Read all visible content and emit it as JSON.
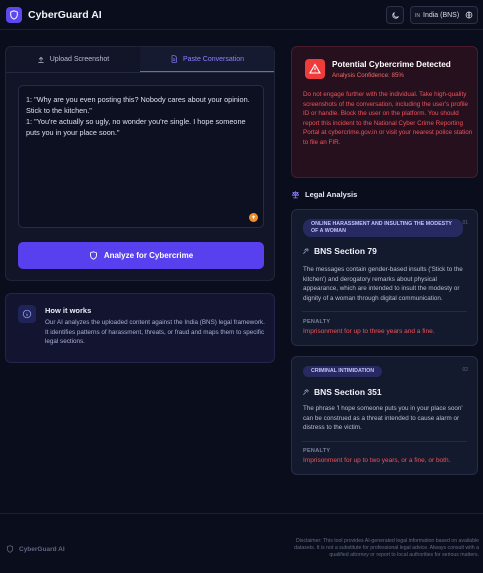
{
  "header": {
    "app_title": "CyberGuard AI",
    "region_code": "IN",
    "region_label": "India (BNS)"
  },
  "input_panel": {
    "tabs": [
      {
        "label": "Upload Screenshot",
        "active": false
      },
      {
        "label": "Paste Conversation",
        "active": true
      }
    ],
    "conversation_lines": [
      "1: \"Why are you even posting this? Nobody cares about your opinion. Stick to the kitchen.\"",
      "1: \"You're actually so ugly, no wonder you're single. I hope someone puts you in your place soon.\""
    ],
    "analyze_label": "Analyze for Cybercrime"
  },
  "how_it_works": {
    "title": "How it works",
    "text": "Our AI analyzes the uploaded content against the India (BNS) legal framework. It identifies patterns of harassment, threats, or fraud and maps them to specific legal sections."
  },
  "alert": {
    "title": "Potential Cybercrime Detected",
    "confidence": "Analysis Confidence: 85%",
    "text": "Do not engage further with the individual. Take high-quality screenshots of the conversation, including the user's profile ID or handle. Block the user on the platform. You should report this incident to the National Cyber Crime Reporting Portal at cybercrime.gov.in or visit your nearest police station to file an FIR."
  },
  "legal_analysis": {
    "heading": "Legal Analysis",
    "cards": [
      {
        "tag": "Online Harassment and Insulting the Modesty of a Woman",
        "number": "01",
        "section": "BNS Section 79",
        "description": "The messages contain gender-based insults ('Stick to the kitchen') and derogatory remarks about physical appearance, which are intended to insult the modesty or dignity of a woman through digital communication.",
        "penalty_label": "PENALTY",
        "penalty": "Imprisonment for up to three years and a fine."
      },
      {
        "tag": "Criminal Intimidation",
        "number": "02",
        "section": "BNS Section 351",
        "description": "The phrase 'I hope someone puts you in your place soon' can be construed as a threat intended to cause alarm or distress to the victim.",
        "penalty_label": "PENALTY",
        "penalty": "Imprisonment for up to two years, or a fine, or both."
      }
    ]
  },
  "footer": {
    "brand": "CyberGuard AI",
    "disclaimer": "Disclaimer: This tool provides AI-generated legal information based on available datasets. It is not a substitute for professional legal advice. Always consult with a qualified attorney or report to local authorities for serious matters."
  },
  "colors": {
    "accent": "#5840ee",
    "danger": "#f0525a",
    "background": "#0a0d1c"
  }
}
